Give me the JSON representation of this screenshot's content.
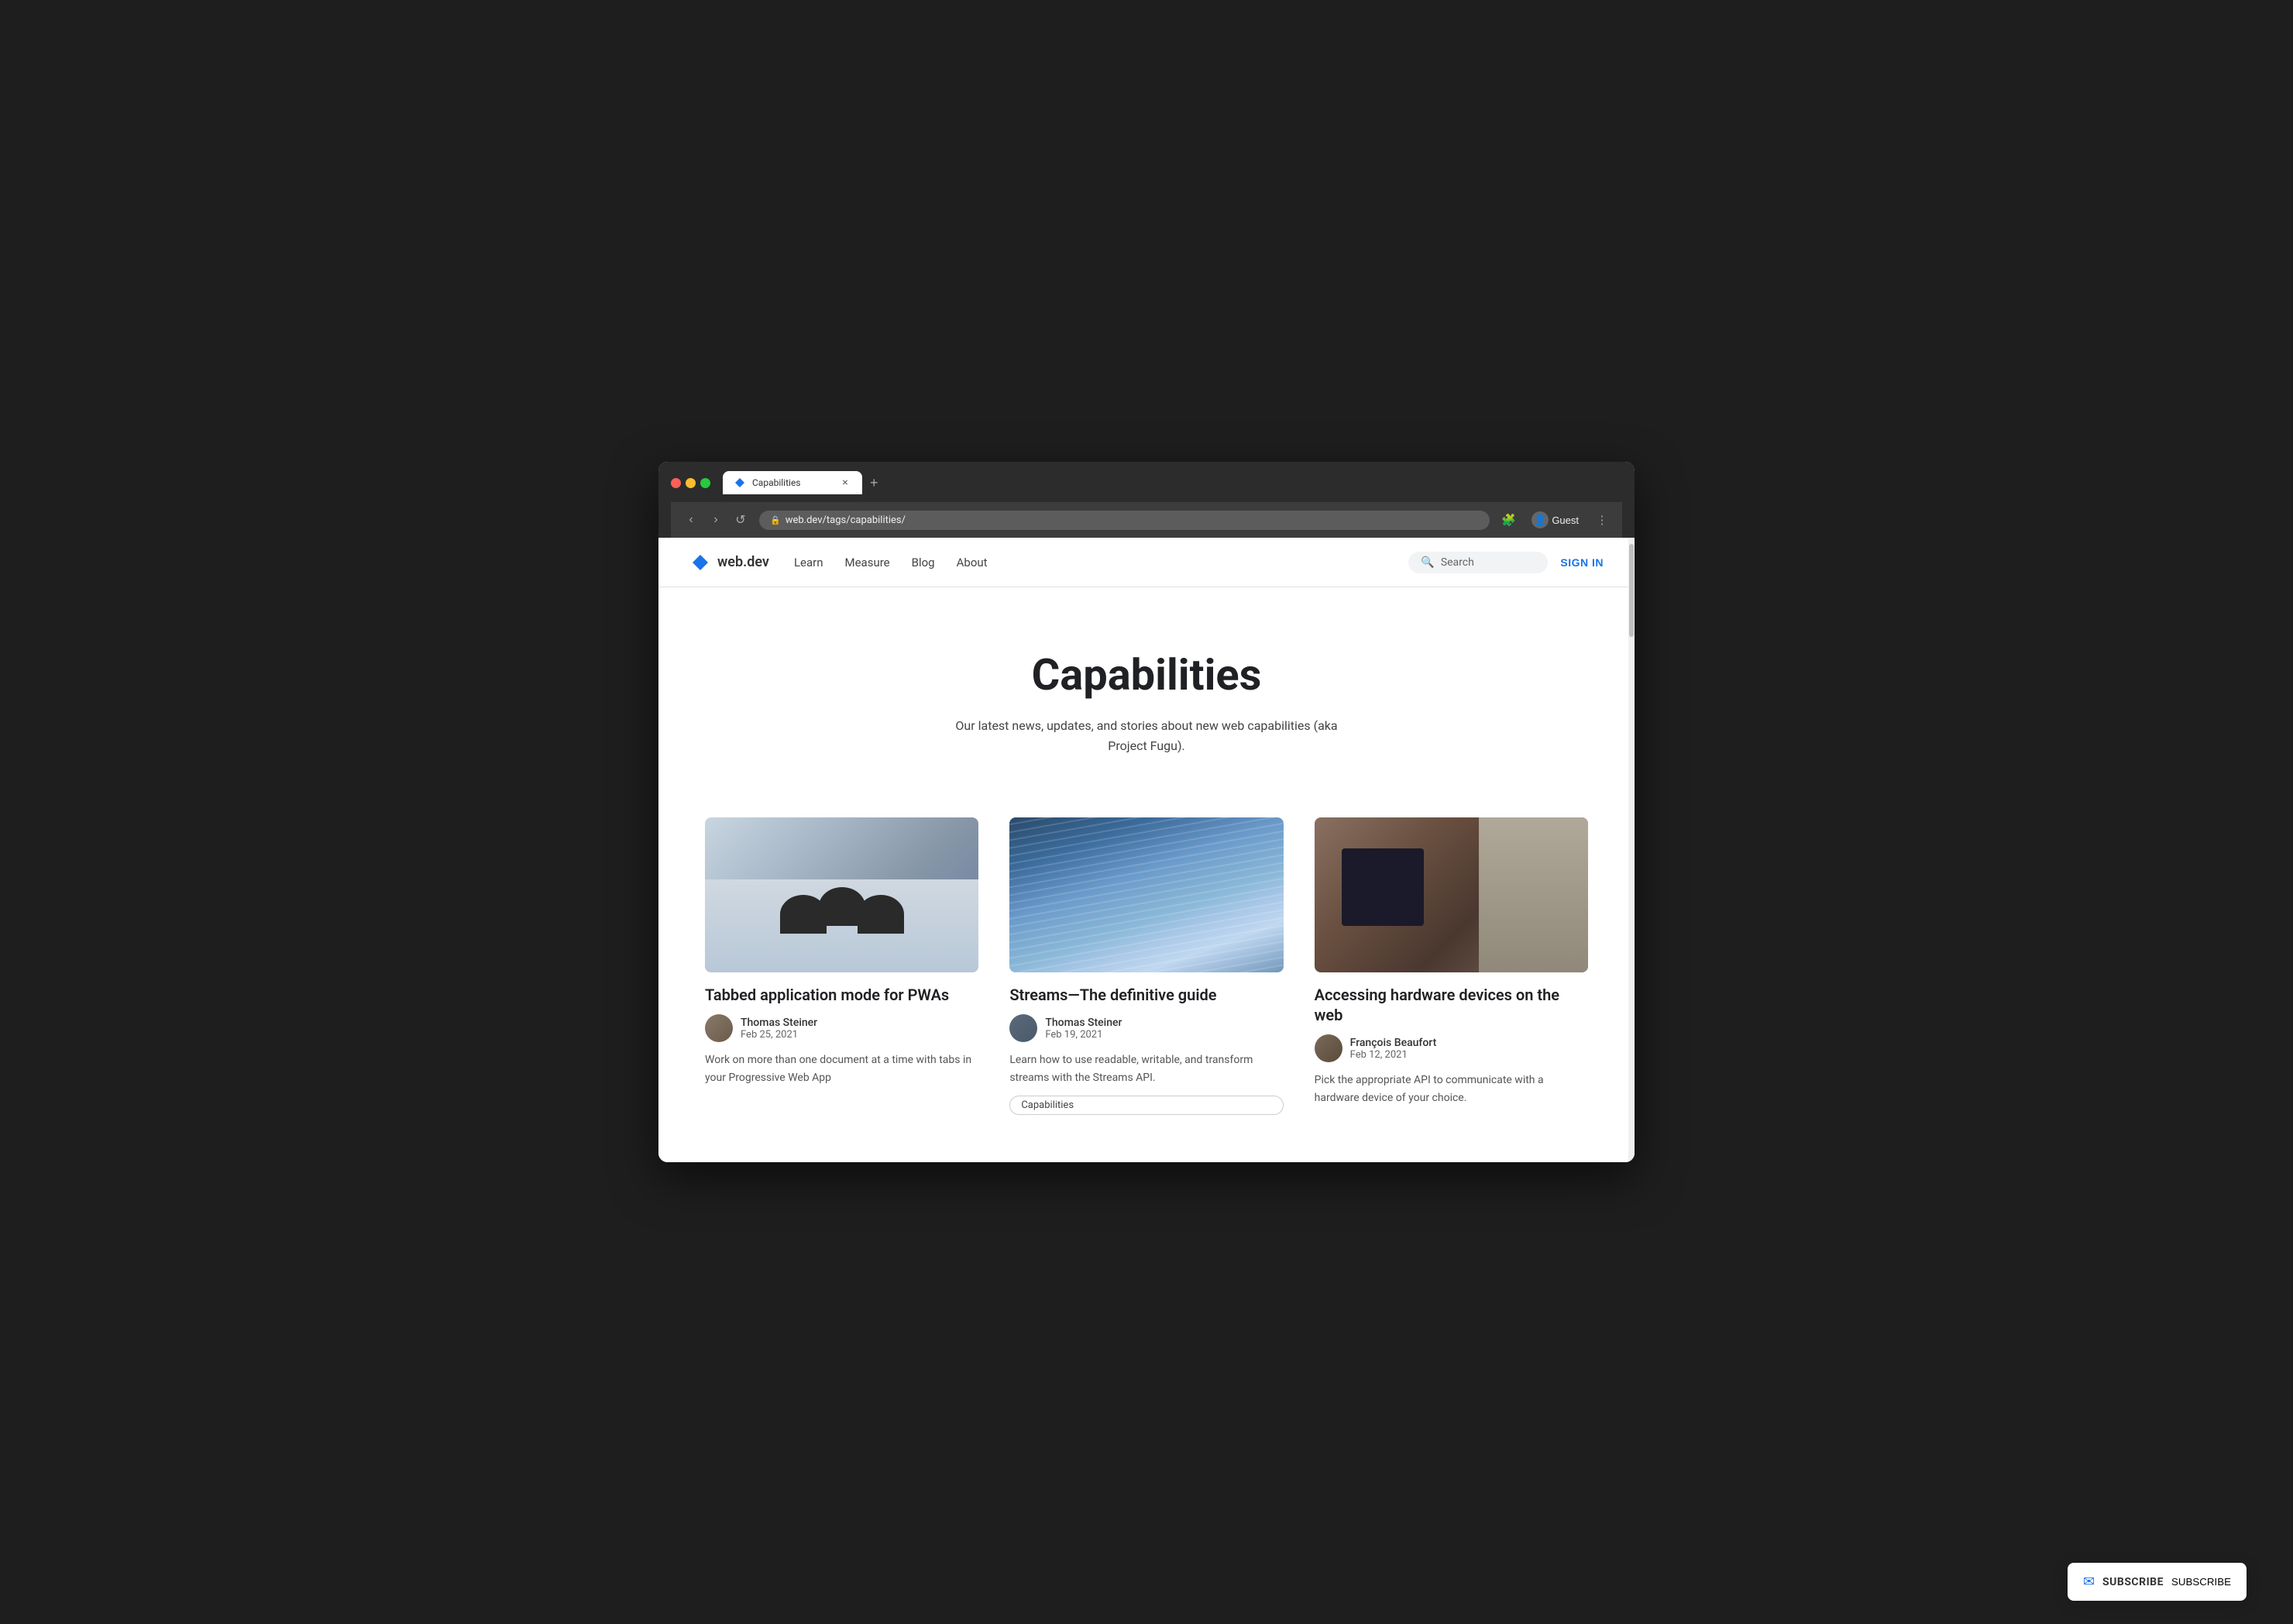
{
  "browser": {
    "tab": {
      "title": "Capabilities",
      "favicon": "📄",
      "close_label": "×",
      "new_tab_label": "+"
    },
    "nav": {
      "back_label": "‹",
      "forward_label": "›",
      "reload_label": "↺",
      "address": "web.dev/tags/capabilities/",
      "lock_icon": "🔒"
    },
    "profile": {
      "icon": "👤",
      "label": "Guest"
    },
    "extensions_icon": "🧩",
    "menu_icon": "⋮"
  },
  "site": {
    "logo": {
      "text": "web.dev",
      "icon_color": "#1a73e8"
    },
    "nav": {
      "items": [
        {
          "label": "Learn",
          "href": "#"
        },
        {
          "label": "Measure",
          "href": "#"
        },
        {
          "label": "Blog",
          "href": "#"
        },
        {
          "label": "About",
          "href": "#"
        }
      ]
    },
    "search": {
      "placeholder": "Search",
      "icon": "🔍"
    },
    "sign_in": "SIGN IN"
  },
  "page": {
    "title": "Capabilities",
    "subtitle": "Our latest news, updates, and stories about new web capabilities (aka Project Fugu)."
  },
  "articles": [
    {
      "title": "Tabbed application mode for PWAs",
      "author": "Thomas Steiner",
      "date": "Feb 25, 2021",
      "description": "Work on more than one document at a time with tabs in your Progressive Web App",
      "image_type": "snow",
      "tag": null
    },
    {
      "title": "Streams—The definitive guide",
      "author": "Thomas Steiner",
      "date": "Feb 19, 2021",
      "description": "Learn how to use readable, writable, and transform streams with the Streams API.",
      "image_type": "water",
      "tag": "Capabilities"
    },
    {
      "title": "Accessing hardware devices on the web",
      "author": "François Beaufort",
      "date": "Feb 12, 2021",
      "description": "Pick the appropriate API to communicate with a hardware device of your choice.",
      "image_type": "workspace",
      "tag": null
    }
  ],
  "subscribe": {
    "label": "SUBSCRIBE",
    "icon": "✉"
  }
}
